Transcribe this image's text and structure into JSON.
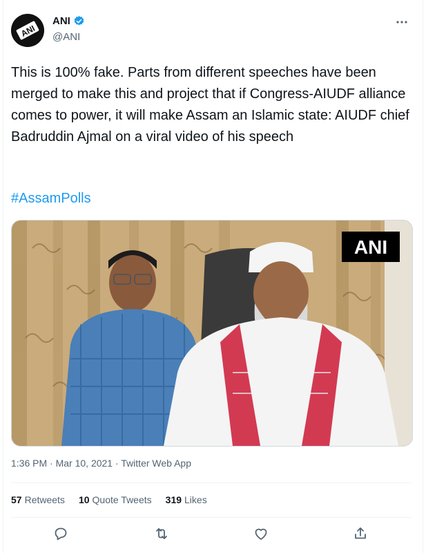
{
  "author": {
    "name": "ANI",
    "handle": "@ANI",
    "avatar_text": "ANI"
  },
  "tweet": {
    "text": "This is 100% fake. Parts from different speeches have been merged to make this and project that if Congress-AIUDF alliance comes to power, it will make Assam an Islamic state: AIUDF chief Badruddin Ajmal on a viral video of his speech",
    "hashtag": "#AssamPolls",
    "media_watermark": "ANI"
  },
  "meta": {
    "time": "1:36 PM",
    "dot1": " · ",
    "date": "Mar 10, 2021",
    "dot2": " · ",
    "app": "Twitter Web App"
  },
  "stats": [
    {
      "count": "57",
      "label": "Retweets"
    },
    {
      "count": "10",
      "label": "Quote Tweets"
    },
    {
      "count": "319",
      "label": "Likes"
    }
  ],
  "icons": {
    "more": "more-icon",
    "reply": "reply-icon",
    "retweet": "retweet-icon",
    "like": "heart-icon",
    "share": "share-icon",
    "verified": "verified-badge-icon"
  },
  "colors": {
    "accent": "#1d9bf0",
    "text": "#0f1419",
    "secondary": "#536471",
    "watermark_bg": "#000000"
  }
}
